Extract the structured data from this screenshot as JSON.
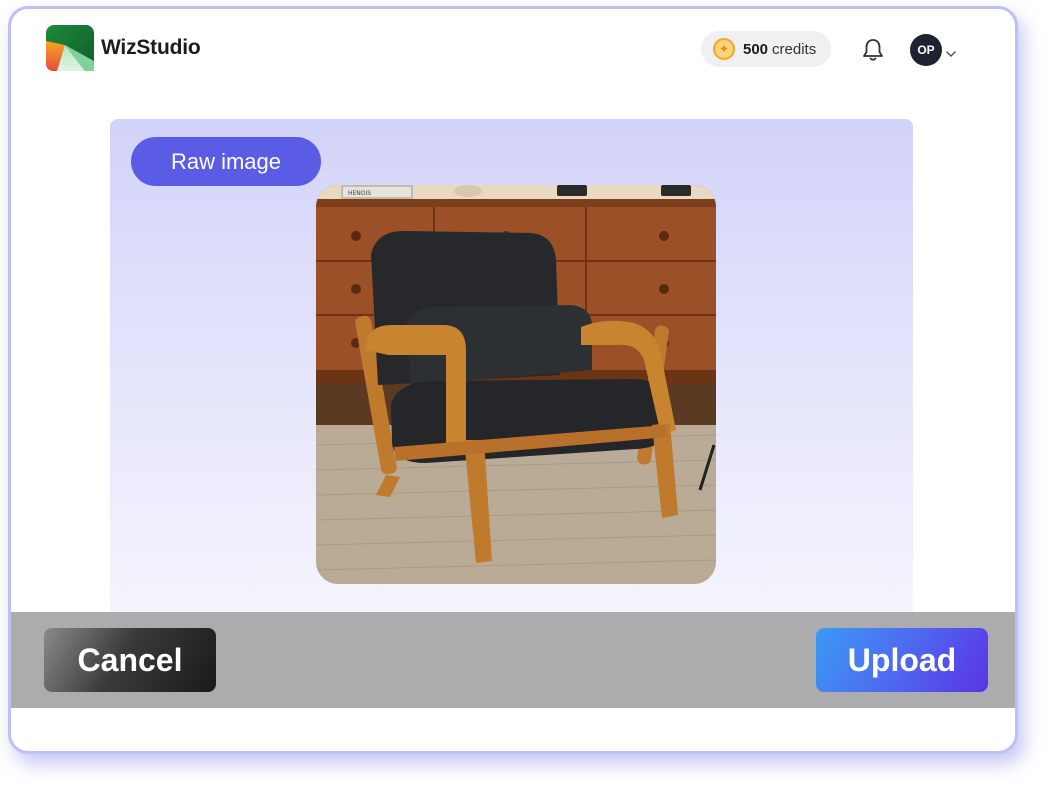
{
  "header": {
    "logo_text": "WizStudio",
    "credits_amount": "500",
    "credits_label": "credits",
    "avatar_initials": "OP",
    "icons": [
      "wizstudio-logo",
      "coin-icon",
      "bell-icon",
      "chevron-down-icon"
    ]
  },
  "main": {
    "raw_chip_label": "Raw image",
    "book_spine_text": "HENOIS"
  },
  "footer": {
    "cancel_label": "Cancel",
    "upload_label": "Upload"
  },
  "colors": {
    "accent": "#5b5ce6",
    "panel_top": "#d3d3fa",
    "upload_start": "#3b9af5",
    "upload_end": "#5a33e6",
    "bottom_bar": "#acacae",
    "coin": "#f4a52a"
  }
}
